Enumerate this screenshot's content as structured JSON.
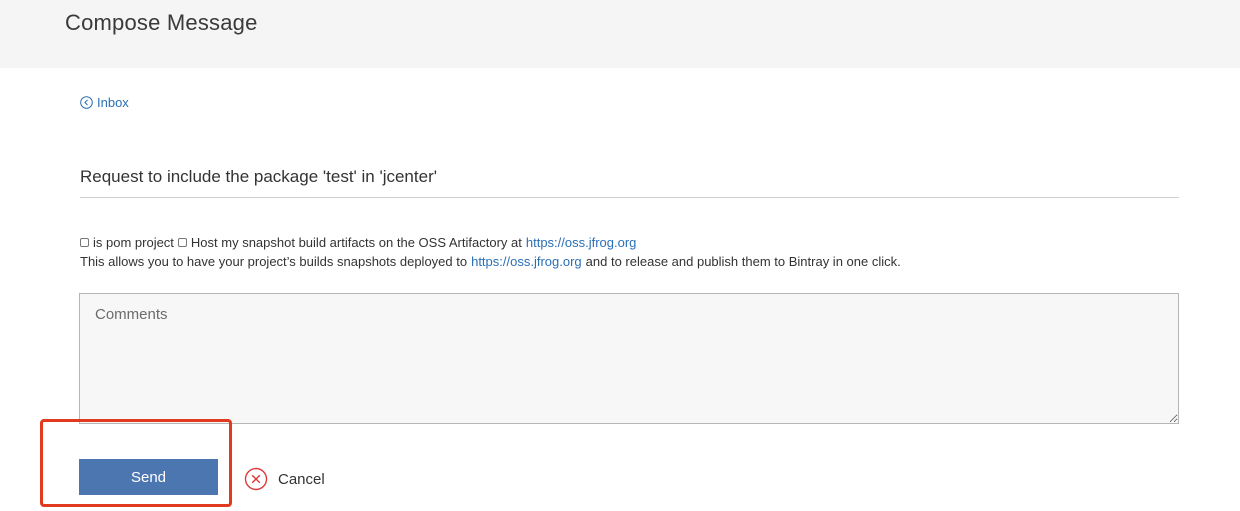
{
  "header": {
    "title": "Compose Message"
  },
  "breadcrumb": {
    "label": "Inbox",
    "icon": "chevron-circle-left-icon"
  },
  "subject": {
    "value": "Request to include the package 'test' in 'jcenter'"
  },
  "options": {
    "pom_checkbox": {
      "label": "is pom project",
      "checked": false
    },
    "snapshot_checkbox": {
      "label": "Host my snapshot build artifacts on the OSS Artifactory at",
      "link": "https://oss.jfrog.org",
      "checked": false
    },
    "description": {
      "before": "This allows you to have your project’s builds snapshots deployed to",
      "link": "https://oss.jfrog.org",
      "after": "and to release and publish them to Bintray in one click."
    }
  },
  "comments": {
    "placeholder": "Comments",
    "value": ""
  },
  "actions": {
    "send_label": "Send",
    "cancel_label": "Cancel",
    "cancel_icon": "close-circle-icon"
  },
  "colors": {
    "link": "#2a6fb5",
    "primary_button": "#4c76b0",
    "cancel_icon": "#e0383b",
    "highlight": "#e23a1e",
    "header_bg": "#f5f5f5"
  }
}
